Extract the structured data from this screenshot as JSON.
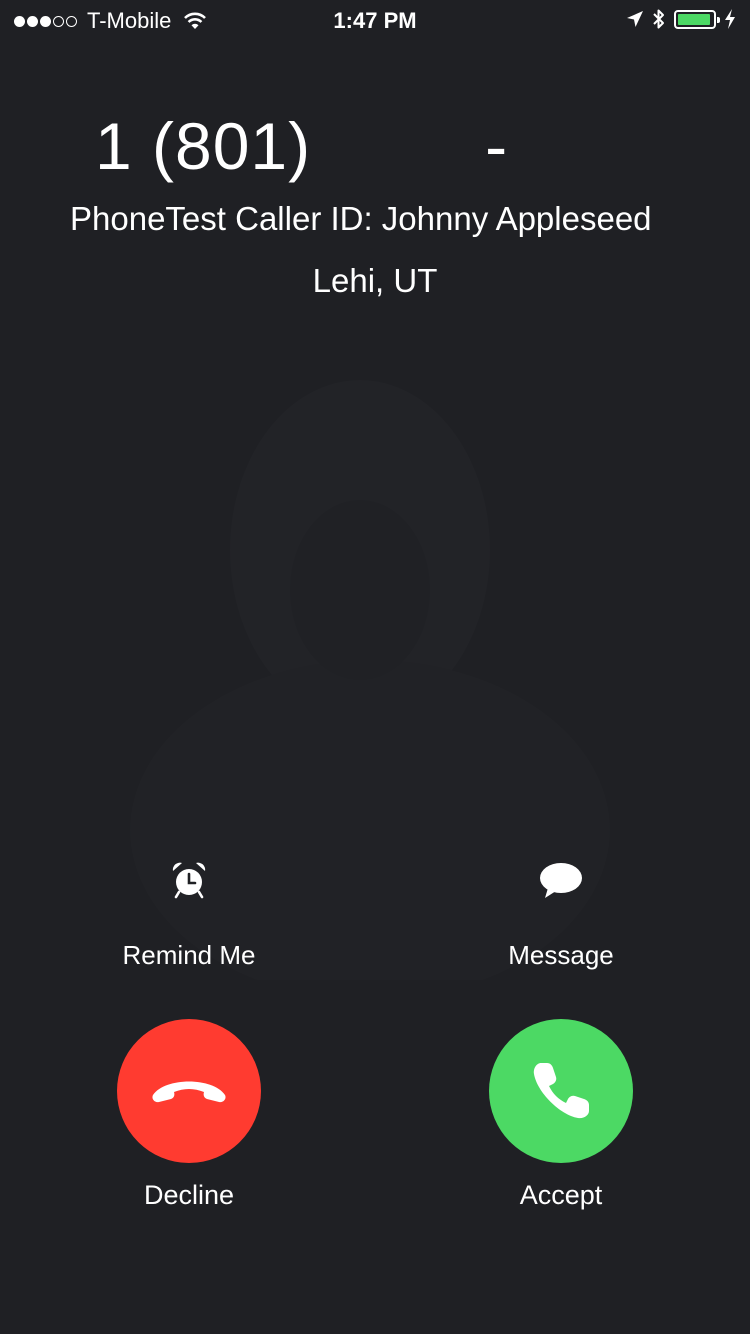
{
  "status_bar": {
    "signal_bars_filled": 3,
    "signal_bars_total": 5,
    "carrier": "T-Mobile",
    "time": "1:47 PM",
    "battery_level": 0.95,
    "icons": [
      "wifi-icon",
      "location-arrow-icon",
      "bluetooth-icon",
      "battery-icon",
      "charging-bolt-icon"
    ]
  },
  "caller": {
    "number": "1 (801)         -",
    "caller_id": "PhoneTest Caller ID: Johnny Appleseed",
    "location": "Lehi, UT"
  },
  "actions": {
    "remind_label": "Remind Me",
    "remind_icon": "alarm-clock-icon",
    "message_label": "Message",
    "message_icon": "speech-bubble-icon"
  },
  "call_buttons": {
    "decline_label": "Decline",
    "decline_color": "#ff3b30",
    "accept_label": "Accept",
    "accept_color": "#4cd964"
  },
  "colors": {
    "background": "#1f2024",
    "text": "#ffffff"
  }
}
